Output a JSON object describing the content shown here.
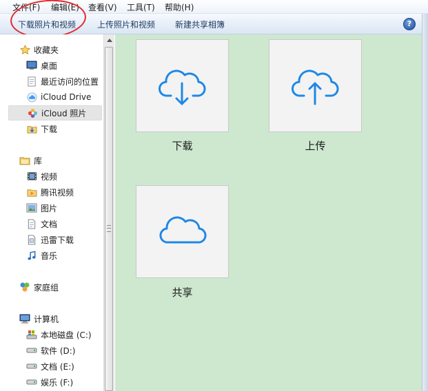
{
  "menubar": {
    "items": [
      {
        "label": "文件(F)"
      },
      {
        "label": "编辑(E)"
      },
      {
        "label": "查看(V)"
      },
      {
        "label": "工具(T)"
      },
      {
        "label": "帮助(H)"
      }
    ]
  },
  "toolbar": {
    "download_label": "下载照片和视频",
    "upload_label": "上传照片和视频",
    "new_shared_label": "新建共享相簿",
    "help_glyph": "?"
  },
  "sidebar": {
    "favorites": {
      "label": "收藏夹",
      "items": [
        {
          "label": "桌面",
          "icon": "desktop-icon"
        },
        {
          "label": "最近访问的位置",
          "icon": "recent-places-icon"
        },
        {
          "label": "iCloud Drive",
          "icon": "icloud-drive-icon"
        },
        {
          "label": "iCloud 照片",
          "icon": "icloud-photos-icon",
          "selected": true
        },
        {
          "label": "下载",
          "icon": "downloads-folder-icon"
        }
      ]
    },
    "libraries": {
      "label": "库",
      "items": [
        {
          "label": "视频",
          "icon": "video-library-icon"
        },
        {
          "label": "腾讯视频",
          "icon": "tencent-video-folder-icon"
        },
        {
          "label": "图片",
          "icon": "pictures-library-icon"
        },
        {
          "label": "文档",
          "icon": "documents-library-icon"
        },
        {
          "label": "迅雷下载",
          "icon": "xunlei-download-folder-icon"
        },
        {
          "label": "音乐",
          "icon": "music-library-icon"
        }
      ]
    },
    "homegroup": {
      "label": "家庭组",
      "icon": "homegroup-icon"
    },
    "computer": {
      "label": "计算机",
      "items": [
        {
          "label": "本地磁盘 (C:)",
          "icon": "system-drive-icon"
        },
        {
          "label": "软件 (D:)",
          "icon": "drive-icon"
        },
        {
          "label": "文档 (E:)",
          "icon": "drive-icon"
        },
        {
          "label": "娱乐 (F:)",
          "icon": "drive-icon"
        }
      ]
    }
  },
  "main": {
    "tiles": [
      {
        "label": "下载",
        "icon": "cloud-download-icon"
      },
      {
        "label": "上传",
        "icon": "cloud-upload-icon"
      },
      {
        "label": "共享",
        "icon": "cloud-icon"
      }
    ]
  },
  "colors": {
    "content_bg": "#cde8cf",
    "cloud_icon": "#1e88e5",
    "annotation": "#e3262d"
  }
}
